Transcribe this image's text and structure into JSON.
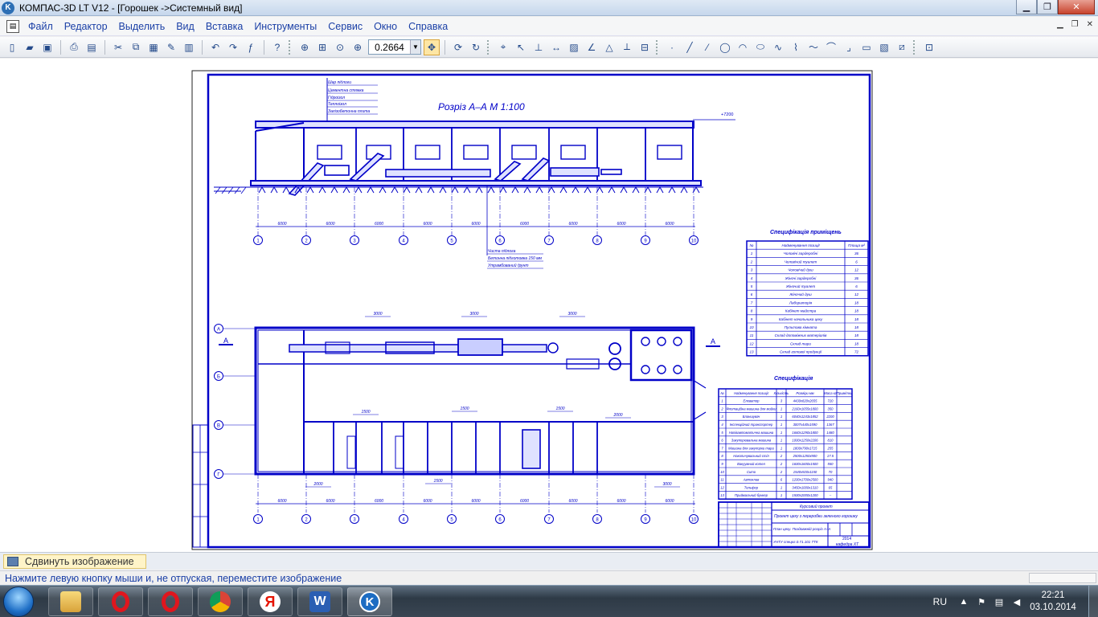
{
  "window": {
    "title": "КОМПАС-3D LT V12 - [Горошек ->Системный вид]",
    "icon": "kompas-icon",
    "controls": [
      "minimize-icon",
      "maximize-icon",
      "close-icon"
    ]
  },
  "menu": {
    "items": [
      "Файл",
      "Редактор",
      "Выделить",
      "Вид",
      "Вставка",
      "Инструменты",
      "Сервис",
      "Окно",
      "Справка"
    ]
  },
  "toolbar": {
    "zoom_value": "0.2664"
  },
  "drawing": {
    "section_title": "Розріз А–А М 1:100",
    "level_mark": "+7200",
    "top_callout": [
      "Шар підлоги",
      "Цементна стяжка",
      "Гідроізол",
      "Теплоізол",
      "Залізобетонна плита"
    ],
    "bottom_callout": [
      "Чиста підлога",
      "Бетонна підготовка 150 мм",
      "Утрамбований ґрунт"
    ],
    "dim_6000": "6000",
    "axis_numbers": [
      "1",
      "2",
      "3",
      "4",
      "5",
      "6",
      "7",
      "8",
      "9",
      "10"
    ],
    "axis_letters": [
      "А",
      "Б",
      "В",
      "Г"
    ],
    "section_marker": "А",
    "plan_dims": [
      "3000",
      "3000",
      "3000",
      "1500",
      "1500",
      "1500",
      "2000",
      "2000",
      "1500",
      "3000"
    ],
    "spec_rooms": {
      "title": "Специфікація приміщень",
      "header": [
        "№",
        "Найменування позиції",
        "Площа м²"
      ],
      "rows": [
        [
          "1",
          "Чоловічі гардеробні",
          "36"
        ],
        [
          "2",
          "Чоловічий туалет",
          "6"
        ],
        [
          "3",
          "Чоловічий душ",
          "12"
        ],
        [
          "4",
          "Жіночі гардеробні",
          "36"
        ],
        [
          "5",
          "Жіночий туалет",
          "6"
        ],
        [
          "6",
          "Жіночий душ",
          "12"
        ],
        [
          "7",
          "Лабораторія",
          "18"
        ],
        [
          "8",
          "Кабінет майстра",
          "18"
        ],
        [
          "9",
          "Кабінет начальника цеху",
          "18"
        ],
        [
          "10",
          "Пультова кімната",
          "18"
        ],
        [
          "11",
          "Склад допоміжних матеріалів",
          "18"
        ],
        [
          "12",
          "Склад тари",
          "18"
        ],
        [
          "13",
          "Склад готової продукції",
          "72"
        ]
      ]
    },
    "spec_equipment": {
      "title": "Специфікація",
      "header": [
        "№",
        "Найменування позиції",
        "Кількість",
        "Розміри мм",
        "Маса кг",
        "Примітки"
      ],
      "rows": [
        [
          "1",
          "Елеватор",
          "3",
          "4430х820х2655",
          "720",
          ""
        ],
        [
          "2",
          "Флотаційна машина для мийки",
          "1",
          "2160х1655х1800",
          "350",
          ""
        ],
        [
          "3",
          "Бланшувач",
          "1",
          "6040х1243х1852",
          "2200",
          ""
        ],
        [
          "4",
          "Інспекційний транспортер",
          "1",
          "3007х440х1590",
          "1367",
          ""
        ],
        [
          "5",
          "Напівавтоматична машина",
          "1",
          "1660х1290х1800",
          "1480",
          ""
        ],
        [
          "6",
          "Закупорювальна машина",
          "1",
          "1000х1250х2206",
          "810",
          ""
        ],
        [
          "7",
          "Машина для закупорки тари",
          "1",
          "1800х790х1715",
          "255",
          ""
        ],
        [
          "8",
          "Накопичувальний стіл",
          "2",
          "2500х1250х900",
          "17.5",
          ""
        ],
        [
          "9",
          "Вакуумний котел",
          "2",
          "1600х1600х1500",
          "550",
          ""
        ],
        [
          "10",
          "Сито",
          "2",
          "1540х920х1150",
          "70",
          ""
        ],
        [
          "11",
          "Автоклав",
          "6",
          "1200х1700х2500",
          "940",
          ""
        ],
        [
          "12",
          "Тельфер",
          "1",
          "3450х1000х1310",
          "65",
          ""
        ],
        [
          "13",
          "Приймальний бункер",
          "1",
          "1500х2000х1200",
          "–",
          ""
        ]
      ]
    },
    "title_block": {
      "course": "Курсовий проект",
      "project": "Проект цеху з переробки зеленого горошку",
      "sheet_name": "План цеху. Поздовжній розріз А–А",
      "year": "2014",
      "dept": "кафедра ХТ",
      "code": "УНТУ спецкл.0.71.101 ТТК"
    }
  },
  "status": {
    "hint_title": "Сдвинуть изображение",
    "hint_text": "Нажмите левую кнопку мыши и, не отпуская, переместите изображение"
  },
  "taskbar": {
    "apps": [
      "explorer-icon",
      "opera-icon",
      "opera-icon",
      "chrome-icon",
      "yandex-icon",
      "word-icon",
      "kompas-icon"
    ],
    "lang": "RU",
    "time": "22:21",
    "date": "03.10.2014"
  },
  "colors": {
    "drawing_blue": "#0000c8",
    "hint_yellow": "#fff4c8",
    "menu_text": "#1a3fa6"
  }
}
